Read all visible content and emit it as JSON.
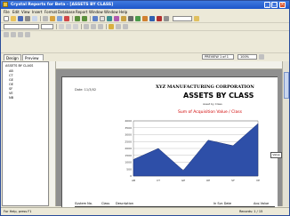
{
  "window": {
    "title": "Crystal Reports for Beta - [ASSETS BY CLASS]"
  },
  "menu": [
    "File",
    "Edit",
    "View",
    "Insert",
    "Format",
    "Database",
    "Report",
    "Window",
    "Window",
    "Help"
  ],
  "tabs": [
    {
      "label": "Design"
    },
    {
      "label": "Preview"
    }
  ],
  "navigator": {
    "page_text": "PREVIEW 1 of 1",
    "zoom": "100%"
  },
  "tree": {
    "items": [
      "ASSETS BY CLASS",
      "AB",
      "CT",
      "GE",
      "OE",
      "SF",
      "VE",
      "NB"
    ]
  },
  "report": {
    "print_date": "Date: 11/3/02",
    "company": "XYZ MANUFACTURING CORPORATION",
    "title": "ASSETS BY CLASS",
    "subtitle": "Asset by Class",
    "chart_title": "Sum of Acquisition Value / Class",
    "legend_label": "Value",
    "columns": [
      "System No.",
      "Class",
      "Description",
      "In Svc Date",
      "Acq Value"
    ]
  },
  "status": {
    "left": "For Help, press F1",
    "right": "Records: 1 / 15"
  },
  "chart_data": {
    "type": "area",
    "title": "Sum of Acquisition Value / Class",
    "categories": [
      "AB",
      "CT",
      "GE",
      "OE",
      "SF",
      "VE"
    ],
    "series": [
      {
        "values": [
          1200,
          2000,
          400,
          2600,
          2200,
          3800
        ]
      }
    ],
    "ylim": [
      0,
      4000
    ],
    "yticks": [
      0,
      500,
      1000,
      1500,
      2000,
      2500,
      3000,
      3500,
      4000
    ],
    "grid": true,
    "fill_color": "#2e4fa8"
  }
}
